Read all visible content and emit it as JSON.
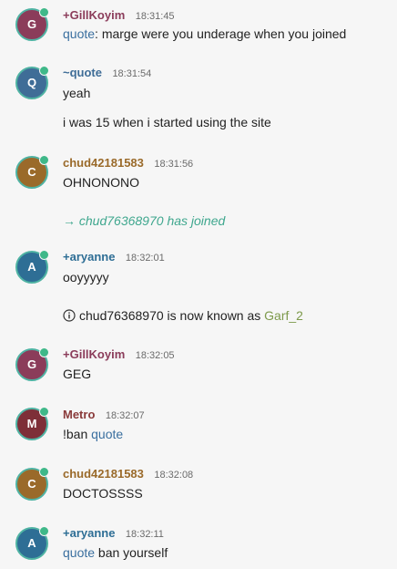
{
  "colors": {
    "avatar_gillkoyim": "#8b3c5a",
    "avatar_quote": "#3f6d97",
    "avatar_chud": "#9a6a2a",
    "avatar_aryanne": "#2e6e95",
    "avatar_metro": "#7e2f38",
    "nick_gillkoyim": "#8b3c5a",
    "nick_quote": "#3f6d97",
    "nick_chud": "#9a6a2a",
    "nick_aryanne": "#2e6e95",
    "nick_metro": "#8a3a3a",
    "status_online": "#3fb889",
    "join_text": "#3fa78e",
    "mention": "#3a6f9f"
  },
  "messages": [
    {
      "avatar_letter": "G",
      "nick": "+GillKoyim",
      "time": "18:31:45",
      "lines": [
        {
          "mention": "quote",
          "text": ": marge were you underage when you joined"
        }
      ]
    },
    {
      "avatar_letter": "Q",
      "nick": "~quote",
      "time": "18:31:54",
      "lines": [
        {
          "text": "yeah"
        },
        {
          "text": "i was 15 when i started using the site"
        }
      ]
    },
    {
      "avatar_letter": "C",
      "nick": "chud42181583",
      "time": "18:31:56",
      "lines": [
        {
          "text": "OHNONONO"
        }
      ]
    },
    {
      "type": "join",
      "arrow": "→",
      "nick": "chud76368970",
      "text": "has joined"
    },
    {
      "avatar_letter": "A",
      "nick": "+aryanne",
      "time": "18:32:01",
      "lines": [
        {
          "text": "ooyyyyy"
        }
      ]
    },
    {
      "type": "nickchange",
      "icon": "info-icon",
      "old_nick": "chud76368970",
      "text": "is now known as",
      "new_nick": "Garf_2"
    },
    {
      "avatar_letter": "G",
      "nick": "+GillKoyim",
      "time": "18:32:05",
      "lines": [
        {
          "text": "GEG"
        }
      ]
    },
    {
      "avatar_letter": "M",
      "nick": "Metro",
      "time": "18:32:07",
      "lines": [
        {
          "prefix": "!ban ",
          "mention": "quote"
        }
      ]
    },
    {
      "avatar_letter": "C",
      "nick": "chud42181583",
      "time": "18:32:08",
      "lines": [
        {
          "text": "DOCTOSSSS"
        }
      ]
    },
    {
      "avatar_letter": "A",
      "nick": "+aryanne",
      "time": "18:32:11",
      "lines": [
        {
          "mention": "quote",
          "text": " ban yourself"
        }
      ]
    }
  ]
}
